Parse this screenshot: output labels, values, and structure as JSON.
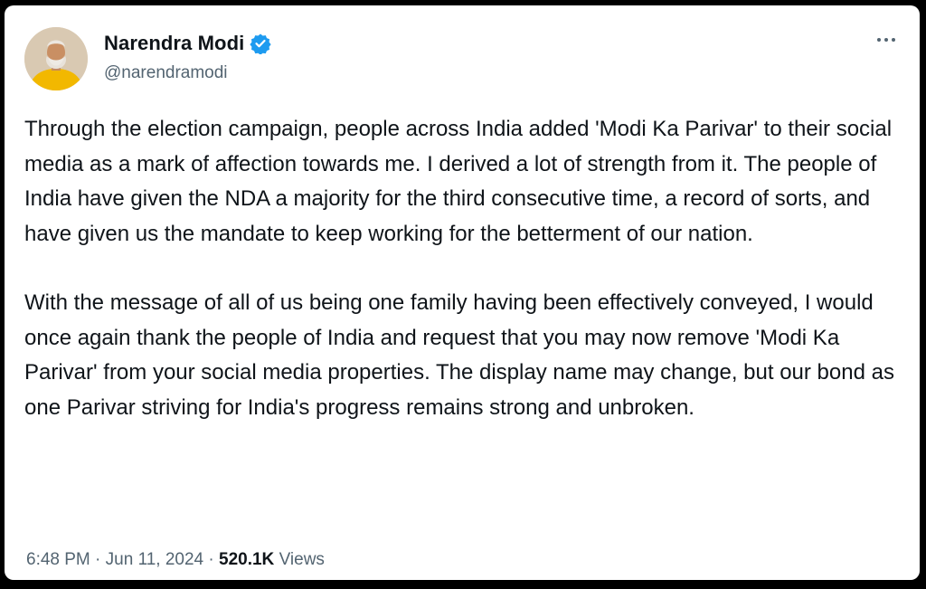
{
  "author": {
    "display_name": "Narendra Modi",
    "handle": "@narendramodi",
    "verified": true,
    "avatar_icon": "profile-photo-icon",
    "verified_icon": "verified-badge-icon",
    "verified_color": "#1d9bf0"
  },
  "more_menu_icon": "more-options-icon",
  "tweet": {
    "paragraphs": [
      "Through the election campaign, people across India added 'Modi Ka Parivar' to their social media as a mark of affection towards me. I derived a lot of strength from it. The people of India have given the NDA a majority for the third consecutive time, a record of sorts, and have given us the mandate to keep working for the betterment of our nation.",
      "With the message of all of us being one family having been effectively conveyed, I would once again thank the people of India and request that you may now remove 'Modi Ka Parivar' from your social media properties. The display name may change, but our bond as one Parivar striving for India's progress remains strong and unbroken."
    ]
  },
  "meta": {
    "time": "6:48 PM",
    "separator": " · ",
    "date": "Jun 11, 2024",
    "views_count": "520.1K",
    "views_label": " Views"
  }
}
